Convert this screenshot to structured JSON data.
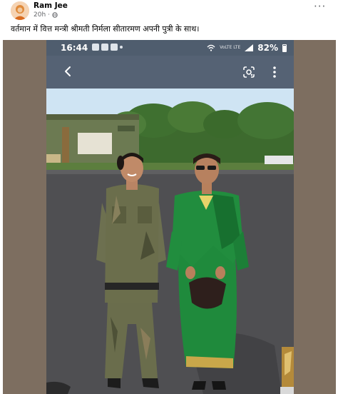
{
  "post": {
    "author": "Ram Jee",
    "time": "20h",
    "privacy_icon": "globe-icon",
    "more_icon": "more-options-icon",
    "caption": "वर्तमान में वित्त मन्त्री श्रीमती निर्मला सीतारमण अपनी पुत्री के साथ।"
  },
  "screenshot": {
    "status_time": "16:44",
    "network": "VoLTE LTE",
    "battery": "82%",
    "nav_icons": [
      "back-arrow-icon",
      "google-lens-icon",
      "kebab-menu-icon"
    ]
  },
  "colors": {
    "phone_bar": "#566375",
    "photo_sky": "#cfe4f3",
    "tarmac": "#4f4f52",
    "saree_green": "#1f8a3c"
  }
}
